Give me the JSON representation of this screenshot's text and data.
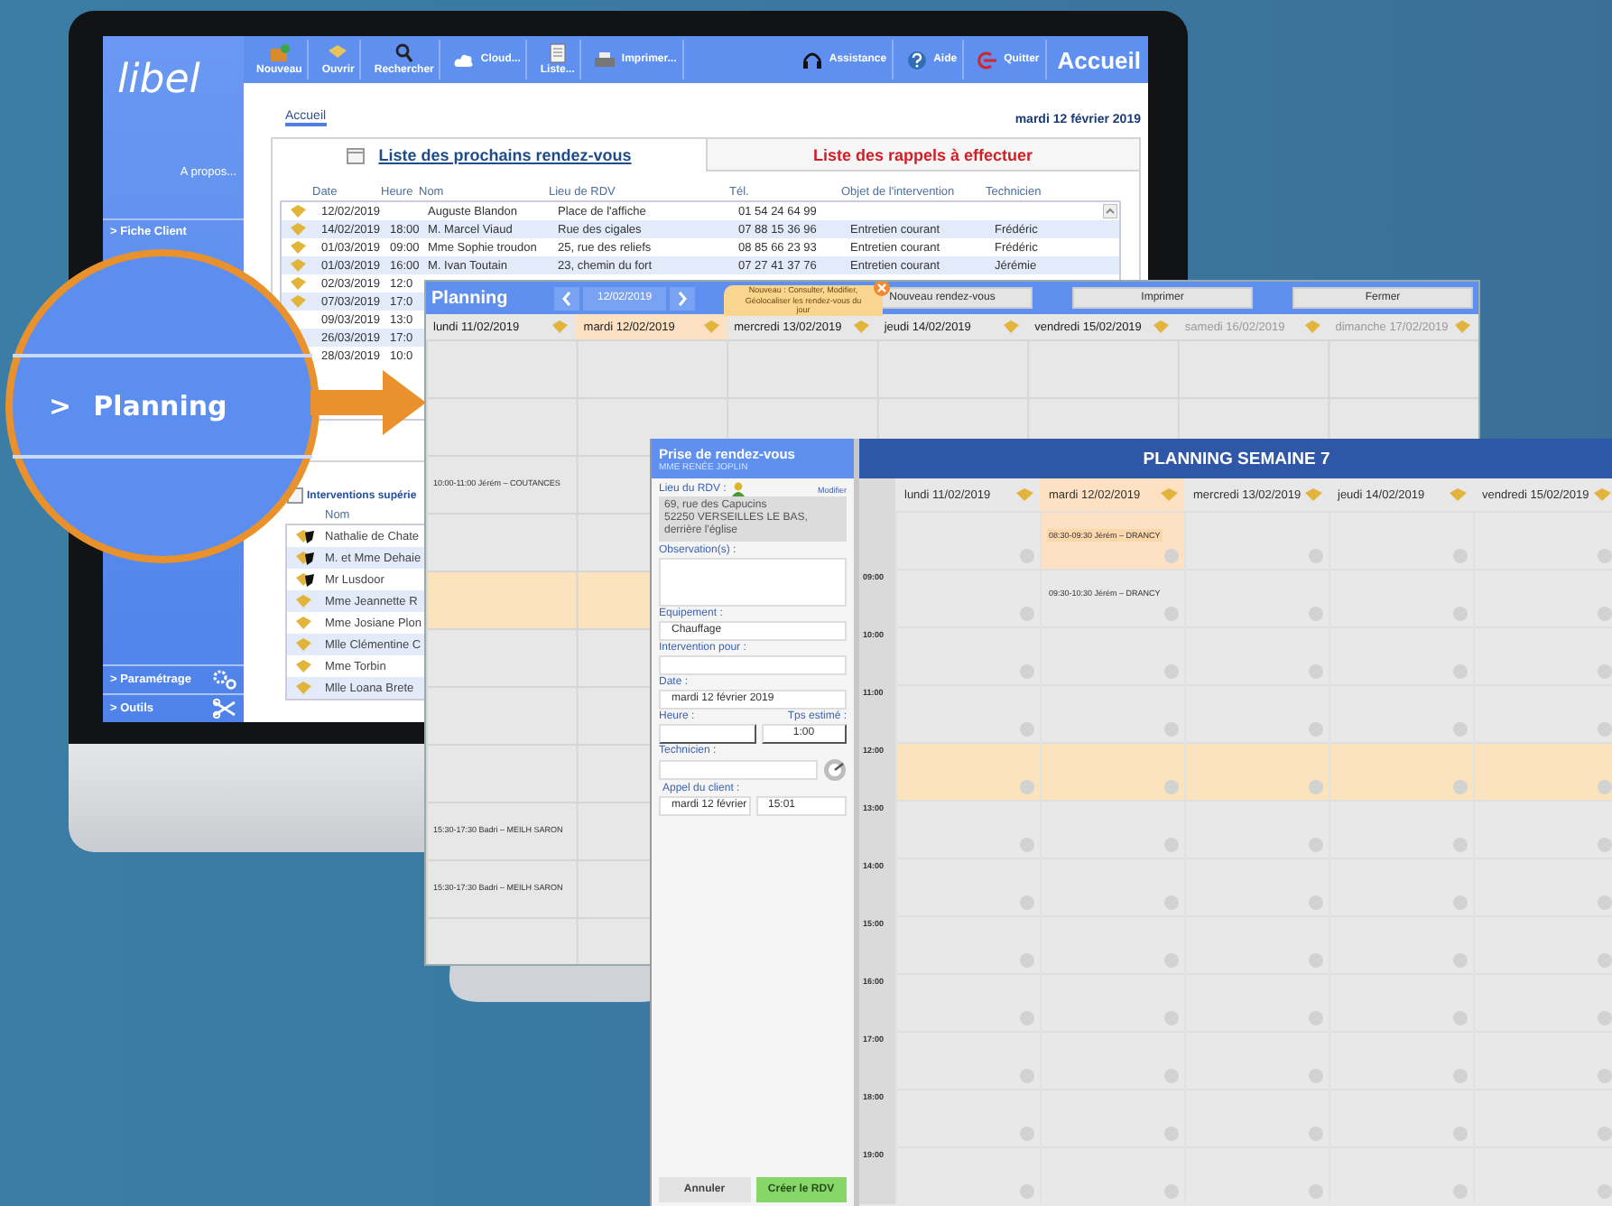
{
  "app": {
    "logo": "libel",
    "about": "A propos...",
    "toolbar": [
      {
        "label": "Nouveau",
        "kind": "stacked"
      },
      {
        "label": "Ouvrir",
        "kind": "stacked"
      },
      {
        "label": "Rechercher",
        "kind": "stacked"
      },
      {
        "label": "Cloud...",
        "kind": "inline"
      },
      {
        "label": "Liste...",
        "kind": "stacked"
      },
      {
        "label": "Imprimer...",
        "kind": "inline"
      },
      {
        "label": "Assistance",
        "kind": "inline"
      },
      {
        "label": "Aide",
        "kind": "inline"
      },
      {
        "label": "Quitter",
        "kind": "inline"
      }
    ],
    "home_button": "Accueil",
    "sidebar": [
      {
        "label": "> Fiche Client"
      }
    ],
    "sidebar_bottom": [
      {
        "label": "> Paramétrage"
      },
      {
        "label": "> Outils"
      }
    ],
    "breadcrumb": "Accueil",
    "date": "mardi 12 février 2019",
    "tabs": [
      {
        "label": "Liste des prochains rendez-vous",
        "selected": true
      },
      {
        "label": "Liste des rappels à effectuer",
        "selected": false
      }
    ],
    "columns": [
      "Date",
      "Heure",
      "Nom",
      "Lieu de RDV",
      "Tél.",
      "Objet de l'intervention",
      "Technicien"
    ],
    "rows": [
      {
        "flag": true,
        "date": "12/02/2019",
        "name": "Auguste Blandon",
        "place": "Place de l'affiche",
        "phone": "01 54 24 64 99"
      },
      {
        "flag": true,
        "date": "14/02/2019",
        "time": "18:00",
        "name": "M. Marcel Viaud",
        "place": "Rue des cigales",
        "phone": "07 88 15 36 96",
        "subject": "Entretien courant",
        "technician": "Frédéric"
      },
      {
        "flag": true,
        "date": "01/03/2019",
        "time": "09:00",
        "name": "Mme Sophie troudon",
        "place": "25, rue des reliefs",
        "phone": "08 85 66 23 93",
        "subject": "Entretien courant",
        "technician": "Frédéric"
      },
      {
        "flag": true,
        "date": "01/03/2019",
        "time": "16:00",
        "name": "M. Ivan Toutain",
        "place": "23, chemin du fort",
        "phone": "07 27 41 37 76",
        "subject": "Entretien courant",
        "technician": "Jérémie"
      },
      {
        "flag": true,
        "date": "02/03/2019",
        "time": "12:0"
      },
      {
        "flag": true,
        "date": "07/03/2019",
        "time": "17:0"
      },
      {
        "date": "09/03/2019",
        "time": "13:0"
      },
      {
        "date": "26/03/2019",
        "time": "17:0"
      },
      {
        "date": "28/03/2019",
        "time": "10:0"
      }
    ],
    "interventions": {
      "title": "Interventions supérie",
      "column": "Nom",
      "items": [
        {
          "name": "Nathalie de Chate",
          "urgent": true
        },
        {
          "name": "M. et Mme Dehaie",
          "urgent": true
        },
        {
          "name": "Mr Lusdoor",
          "urgent": true
        },
        {
          "name": "Mme Jeannette R",
          "urgent": false
        },
        {
          "name": "Mme Josiane Plon",
          "urgent": false
        },
        {
          "name": "Mlle Clémentine C",
          "urgent": false
        },
        {
          "name": "Mme Torbin",
          "urgent": false
        },
        {
          "name": "Mlle Loana Brete",
          "urgent": false
        }
      ]
    }
  },
  "magnifier": {
    "marker": ">",
    "label": "Planning"
  },
  "planning": {
    "title": "Planning",
    "date": "12/02/2019",
    "tooltip": "Nouveau : Consulter, Modifier, Géolocaliser les rendez-vous du jour",
    "buttons": [
      "Nouveau rendez-vous",
      "Imprimer",
      "Fermer"
    ],
    "days": [
      {
        "label": "lundi 11/02/2019",
        "selected": false,
        "disabled": false
      },
      {
        "label": "mardi 12/02/2019",
        "selected": true,
        "disabled": false
      },
      {
        "label": "mercredi 13/02/2019",
        "selected": false,
        "disabled": false
      },
      {
        "label": "jeudi 14/02/2019",
        "selected": false,
        "disabled": false
      },
      {
        "label": "vendredi 15/02/2019",
        "selected": false,
        "disabled": false
      },
      {
        "label": "samedi 16/02/2019",
        "selected": false,
        "disabled": true
      },
      {
        "label": "dimanche 17/02/2019",
        "selected": false,
        "disabled": true
      }
    ],
    "rows": [
      {
        "lunch": false
      },
      {
        "lunch": false
      },
      {
        "lunch": false,
        "event": "10:00-11:00 Jérém – COUTANCES"
      },
      {
        "lunch": false
      },
      {
        "lunch": true
      },
      {
        "lunch": false
      },
      {
        "lunch": false
      },
      {
        "lunch": false
      },
      {
        "lunch": false,
        "event": "15:30-17:30 Badri – MEILH SARON"
      },
      {
        "lunch": false,
        "event": "15:30-17:30 Badri – MEILH SARON"
      },
      {
        "lunch": false
      }
    ]
  },
  "booking": {
    "title": "Prise de rendez-vous",
    "client": "MME RENÉE JOPLIN",
    "location_label": "Lieu du RDV :",
    "modify_link": "Modifier",
    "address": [
      "69, rue des Capucins",
      "52250 VERSEILLES LE BAS,",
      "derrière l'église"
    ],
    "observation_label": "Observation(s) :",
    "equipment_label": "Equipement :",
    "equipment_value": "Chauffage",
    "intervention_label": "Intervention pour :",
    "date_label": "Date :",
    "date_value": "mardi 12 février 2019",
    "hour_label": "Heure :",
    "estimate_label": "Tps estimé :",
    "estimate_value": "1:00",
    "technician_label": "Technicien :",
    "call_label": "Appel du client :",
    "call_date": "mardi 12 février",
    "call_time": "15:01",
    "cancel": "Annuler",
    "create": "Créer le RDV"
  },
  "week": {
    "title": "PLANNING SEMAINE 7",
    "days": [
      {
        "label": "lundi 11/02/2019",
        "selected": false
      },
      {
        "label": "mardi 12/02/2019",
        "selected": true
      },
      {
        "label": "mercredi 13/02/2019",
        "selected": false
      },
      {
        "label": "jeudi 14/02/2019",
        "selected": false
      },
      {
        "label": "vendredi 15/02/2019",
        "selected": false
      }
    ],
    "rows": [
      {
        "lunch": false,
        "event": {
          "text": "08:30-09:30 Jérém – DRANCY",
          "highlighted": true
        }
      },
      {
        "label": "09:00",
        "lunch": false,
        "event": {
          "text": "09:30-10:30 Jérém – DRANCY",
          "highlighted": false
        }
      },
      {
        "label": "10:00",
        "lunch": false
      },
      {
        "label": "11:00",
        "lunch": false
      },
      {
        "label": "12:00",
        "lunch": true
      },
      {
        "label": "13:00",
        "lunch": false
      },
      {
        "label": "14:00",
        "lunch": false
      },
      {
        "label": "15:00",
        "lunch": false
      },
      {
        "label": "16:00",
        "lunch": false
      },
      {
        "label": "17:00",
        "lunch": false
      },
      {
        "label": "18:00",
        "lunch": false
      },
      {
        "label": "19:00",
        "lunch": false
      }
    ]
  }
}
